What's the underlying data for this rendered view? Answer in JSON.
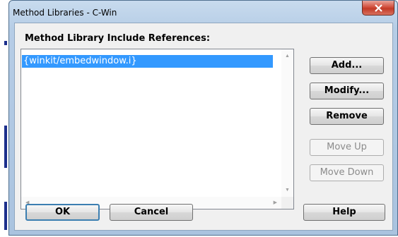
{
  "window": {
    "title": "Method Libraries - C-Win"
  },
  "dialog": {
    "list_label": "Method Library Include References:",
    "list_items": [
      "{winkit/embedwindow.i}"
    ],
    "buttons": {
      "add": "Add...",
      "modify": "Modify...",
      "remove": "Remove",
      "move_up": "Move Up",
      "move_down": "Move Down",
      "ok": "OK",
      "cancel": "Cancel",
      "help": "Help"
    }
  },
  "colors": {
    "selection": "#3399ff",
    "close_button": "#c23a27",
    "dialog_bg": "#f0f0f0",
    "frame": "#b6cde6"
  },
  "icons": [
    "close-icon",
    "scroll-up-icon",
    "scroll-down-icon",
    "scroll-left-icon",
    "scroll-right-icon"
  ]
}
